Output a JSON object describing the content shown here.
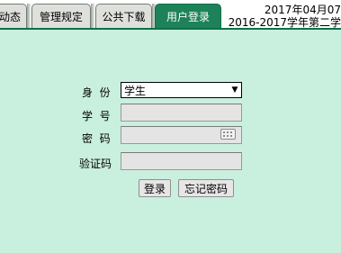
{
  "tabs": [
    {
      "label": "动态",
      "active": false
    },
    {
      "label": "管理规定",
      "active": false
    },
    {
      "label": "公共下载",
      "active": false
    },
    {
      "label": "用户登录",
      "active": true
    }
  ],
  "header": {
    "date": "2017年04月07",
    "term": "2016-2017学年第二学"
  },
  "login_form": {
    "identity_label": "身  份",
    "identity_value": "学生",
    "student_id_label": "学  号",
    "student_id_value": "",
    "password_label": "密  码",
    "password_value": "",
    "captcha_label": "验证码",
    "captcha_value": "",
    "login_button": "登录",
    "forgot_button": "忘记密码"
  },
  "colors": {
    "background": "#c9efdf",
    "active_tab": "#1d8259",
    "inactive_tab": "#dfe0dc"
  },
  "icons": {
    "password_keyboard": "keyboard-icon",
    "select_arrow": "triangle-down"
  }
}
